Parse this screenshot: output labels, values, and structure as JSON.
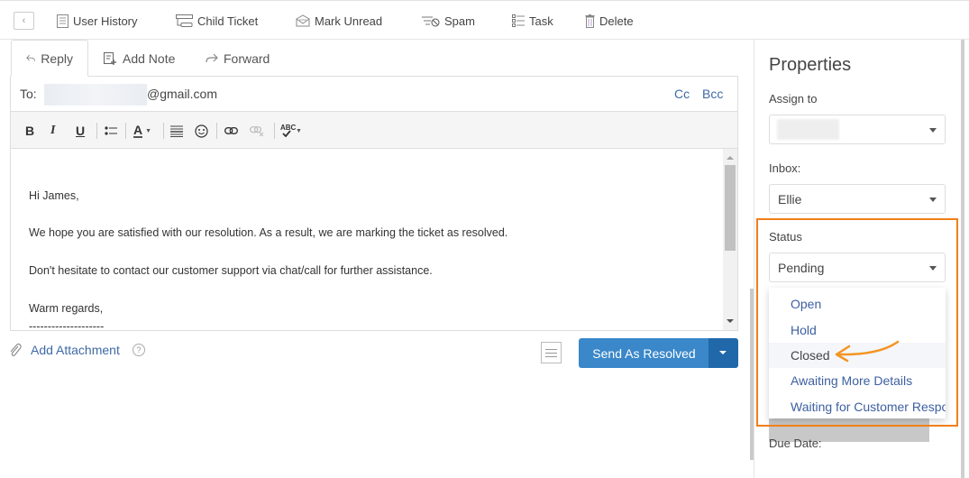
{
  "toolbar": {
    "back_icon": "chevron-left-icon",
    "items": [
      {
        "label": "User History",
        "icon": "document-icon"
      },
      {
        "label": "Child Ticket",
        "icon": "child-ticket-icon"
      },
      {
        "label": "Mark Unread",
        "icon": "envelope-icon"
      },
      {
        "label": "Spam",
        "icon": "spam-icon"
      },
      {
        "label": "Task",
        "icon": "task-list-icon"
      },
      {
        "label": "Delete",
        "icon": "trash-icon"
      }
    ]
  },
  "composer": {
    "tabs": [
      {
        "label": "Reply",
        "icon": "reply-icon",
        "active": true
      },
      {
        "label": "Add Note",
        "icon": "add-note-icon",
        "active": false
      },
      {
        "label": "Forward",
        "icon": "forward-icon",
        "active": false
      }
    ],
    "to_label": "To:",
    "to_domain": "@gmail.com",
    "cc_label": "Cc",
    "bcc_label": "Bcc",
    "format_buttons": [
      "B",
      "I",
      "U",
      "bulleted-list",
      "font-color",
      "align",
      "emoji",
      "link",
      "unlink",
      "spellcheck"
    ],
    "font_color_label": "A",
    "spellcheck_label": "ABC",
    "body_lines": [
      "Hi James,",
      "We hope you are satisfied with our resolution. As a result, we are marking the ticket as resolved.",
      "Don't hesitate to contact our customer support via chat/call for further assistance.",
      "Warm regards,",
      "--------------------"
    ],
    "attachment_label": "Add Attachment",
    "help_label": "?",
    "send_label": "Send As Resolved"
  },
  "properties": {
    "title": "Properties",
    "assign_label": "Assign to",
    "inbox_label": "Inbox:",
    "inbox_value": "Ellie",
    "status_label": "Status",
    "status_value": "Pending",
    "status_options": [
      "Open",
      "Hold",
      "Closed",
      "Awaiting More Details",
      "Waiting for Customer Response"
    ],
    "highlighted_option": "Closed",
    "due_date_label": "Due Date:",
    "highlight_color": "#f07f1a"
  }
}
